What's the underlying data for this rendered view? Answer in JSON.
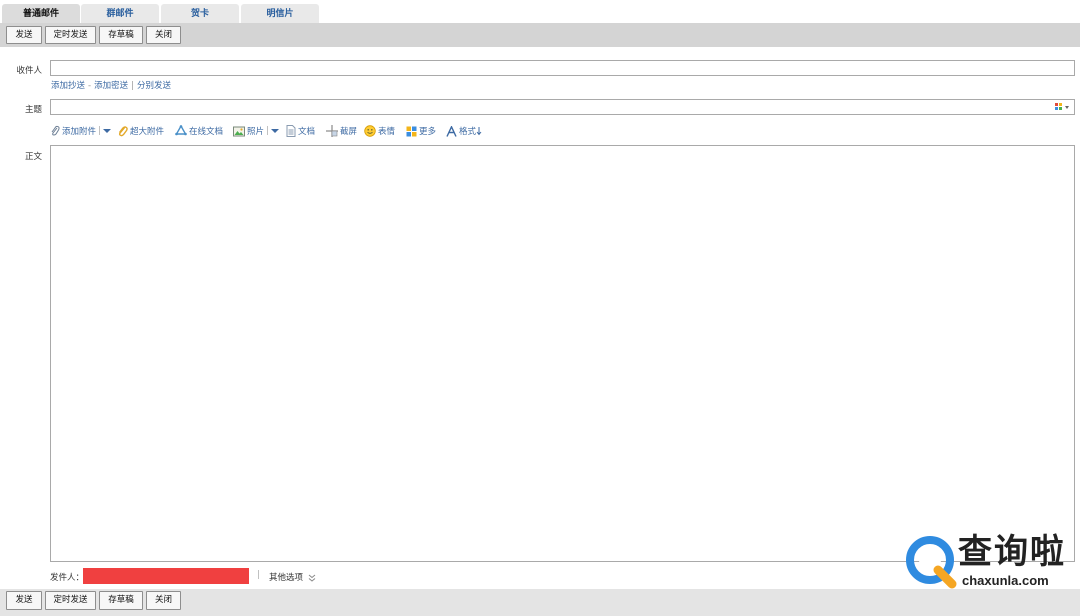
{
  "tabs": [
    "普通邮件",
    "群邮件",
    "贺卡",
    "明信片"
  ],
  "toolbar": {
    "send": "发送",
    "scheduled_send": "定时发送",
    "save_draft": "存草稿",
    "close": "关闭"
  },
  "recipient": {
    "label": "收件人",
    "value": "",
    "add_cc": "添加抄送",
    "add_bcc": "添加密送",
    "separate_send": "分别发送",
    "dash": "-",
    "bar": "|"
  },
  "subject": {
    "label": "主题",
    "value": ""
  },
  "format_toolbar": {
    "add_attachment": "添加附件",
    "large_attachment": "超大附件",
    "online_doc": "在线文档",
    "photo": "照片",
    "document": "文档",
    "screenshot": "截屏",
    "emoji": "表情",
    "more": "更多",
    "format": "格式"
  },
  "body": {
    "label": "正文",
    "value": ""
  },
  "sender": {
    "label": "发件人：",
    "other_options": "其他选项",
    "bar": "|"
  },
  "watermark": {
    "text": "查询啦",
    "url": "chaxunla.com"
  },
  "colors": {
    "link": "#3d6aa3",
    "toolbar_bg": "#d4d4d4",
    "redacted": "#f04040",
    "watermark_blue": "#2f8be0",
    "watermark_orange": "#f5a623"
  }
}
